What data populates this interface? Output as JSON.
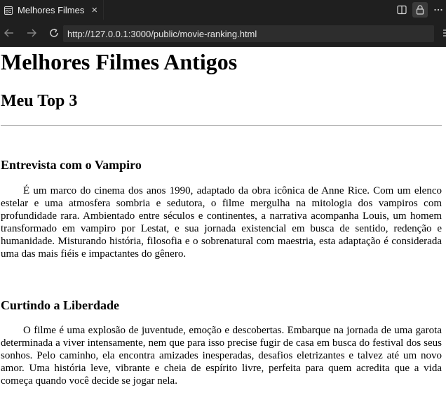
{
  "browser": {
    "tab_title": "Melhores Filmes",
    "tab_icon": "page-icon",
    "close_icon": "×",
    "url": "http://127.0.0.1:3000/public/movie-ranking.html",
    "colors": {
      "chrome": "#1f1f1f",
      "url_bg": "#2d2d2d",
      "text": "#e8e8e8"
    }
  },
  "page": {
    "title": "Melhores Filmes Antigos",
    "subtitle": "Meu Top 3",
    "movies": [
      {
        "name": "Entrevista com o Vampiro",
        "description": "É um marco do cinema dos anos 1990, adaptado da obra icônica de Anne Rice. Com um elenco estelar e uma atmosfera sombria e sedutora, o filme mergulha na mitologia dos vampiros com profundidade rara. Ambientado entre séculos e continentes, a narrativa acompanha Louis, um homem transformado em vampiro por Lestat, e sua jornada existencial em busca de sentido, redenção e humanidade. Misturando história, filosofia e o sobrenatural com maestria, esta adaptação é considerada uma das mais fiéis e impactantes do gênero."
      },
      {
        "name": "Curtindo a Liberdade",
        "description": "O filme é uma explosão de juventude, emoção e descobertas. Embarque na jornada de uma garota determinada a viver intensamente, nem que para isso precise fugir de casa em busca do festival dos seus sonhos. Pelo caminho, ela encontra amizades inesperadas, desafios eletrizantes e talvez até um novo amor. Uma história leve, vibrante e cheia de espírito livre, perfeita para quem acredita que a vida começa quando você decide se jogar nela."
      }
    ]
  }
}
